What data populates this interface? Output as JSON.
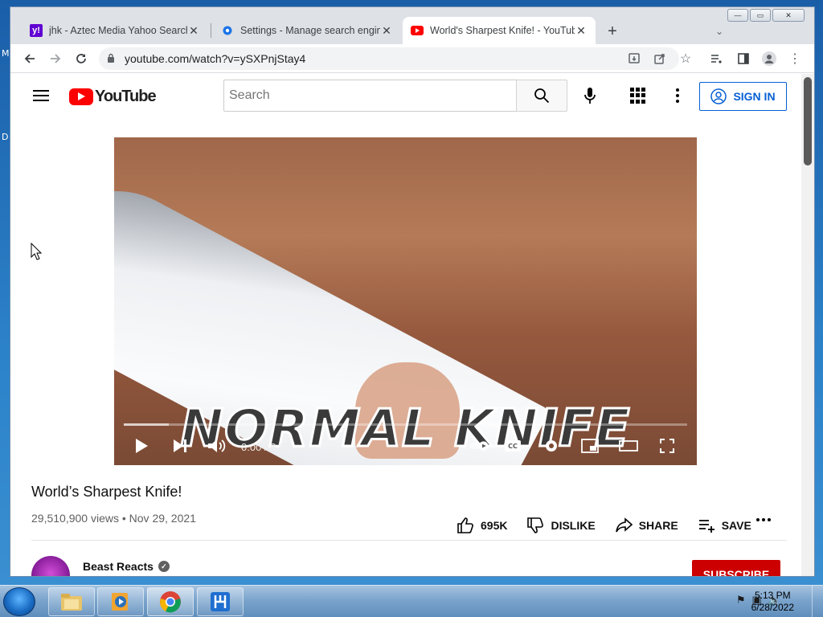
{
  "desktop": {
    "side_labels": [
      "M",
      "D"
    ]
  },
  "browser": {
    "tabs": [
      {
        "title": "jhk - Aztec Media Yahoo Search R",
        "favicon": "yahoo-icon",
        "color": "#6001d2",
        "active": false
      },
      {
        "title": "Settings - Manage search engine",
        "favicon": "settings-gear-icon",
        "color": "#1a73e8",
        "active": false
      },
      {
        "title": "World's Sharpest Knife! - YouTub",
        "favicon": "youtube-icon",
        "color": "#ff0000",
        "active": true
      }
    ],
    "new_tab_label": "+",
    "address": "youtube.com/watch?v=ySXPnjStay4"
  },
  "youtube": {
    "logo_text": "YouTube",
    "search_placeholder": "Search",
    "sign_in_label": "SIGN IN",
    "player": {
      "caption": "NORMAL KNIFE",
      "time": "0:00 / 8:01",
      "buffered_fraction": 0.08
    },
    "video": {
      "title": "World’s Sharpest Knife!",
      "views": "29,510,900 views",
      "date": "Nov 29, 2021",
      "likes": "695K",
      "dislike_label": "DISLIKE",
      "share_label": "SHARE",
      "save_label": "SAVE"
    },
    "channel": {
      "name": "Beast Reacts",
      "subscribe_label": "SUBSCRIBE"
    }
  },
  "taskbar": {
    "time": "5:13 PM",
    "date": "6/28/2022"
  },
  "colors": {
    "youtube_red": "#ff0000",
    "link_blue": "#065fd4",
    "subscribe_red": "#cc0000"
  }
}
